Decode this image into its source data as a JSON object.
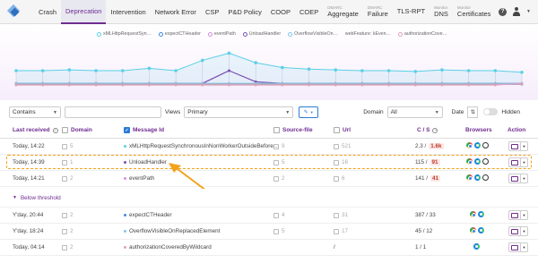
{
  "nav": {
    "tabs": [
      {
        "label": "Crash"
      },
      {
        "label": "Deprecation",
        "active": true
      },
      {
        "label": "Intervention"
      },
      {
        "label": "Network Error"
      },
      {
        "label": "CSP"
      },
      {
        "label": "P&D Policy"
      },
      {
        "label": "COOP"
      },
      {
        "label": "COEP"
      }
    ],
    "two_line_tabs": [
      {
        "small": "DMARC",
        "big": "Aggregate"
      },
      {
        "small": "DMARC",
        "big": "Failure"
      },
      {
        "small": "",
        "big": "TLS-RPT"
      },
      {
        "small": "Monitor",
        "big": "DNS"
      },
      {
        "small": "Monitor",
        "big": "Certificates"
      }
    ],
    "help_label": "?"
  },
  "chart": {
    "legend": [
      {
        "label": "xMLHttpRequestSyn…",
        "color": "#5ad0e6"
      },
      {
        "label": "expectCTHeader",
        "color": "#3d8ae0"
      },
      {
        "label": "eventPath",
        "color": "#d38ee0"
      },
      {
        "label": "UnloadHandler",
        "color": "#7a4fb5"
      },
      {
        "label": "OverflowVisibleOn…",
        "color": "#7fc6f0"
      },
      {
        "label": "webFeature: kEven…",
        "color": "#aaaaaa"
      },
      {
        "label": "authorizationCove…",
        "color": "#e0a0c0"
      }
    ],
    "colors": {
      "accent": "#6f2c91",
      "highlight": "#f2a21b",
      "link": "#2b7bd6"
    }
  },
  "chart_data": {
    "type": "line",
    "x": [
      1,
      2,
      3,
      4,
      5,
      6,
      7,
      8,
      9,
      10,
      11,
      12,
      13,
      14,
      15,
      16,
      17,
      18,
      19,
      20
    ],
    "series": [
      {
        "name": "xMLHttpRequestSyn…",
        "values": [
          18,
          18,
          19,
          18,
          18,
          21,
          18,
          31,
          40,
          28,
          22,
          20,
          19,
          18,
          18,
          17,
          19,
          18,
          18,
          16
        ]
      },
      {
        "name": "expectCTHeader",
        "values": [
          1,
          1,
          1,
          1,
          1,
          1,
          1,
          1,
          1,
          1,
          1,
          1,
          1,
          1,
          1,
          1,
          1,
          1,
          1,
          1
        ]
      },
      {
        "name": "eventPath",
        "values": [
          1,
          1,
          1,
          1,
          1,
          1,
          1,
          1,
          1,
          1,
          1,
          1,
          1,
          1,
          1,
          1,
          1,
          1,
          1,
          1
        ]
      },
      {
        "name": "UnloadHandler",
        "values": [
          2,
          2,
          2,
          2,
          2,
          2,
          2,
          2,
          18,
          4,
          2,
          2,
          2,
          2,
          2,
          2,
          2,
          2,
          2,
          2
        ]
      },
      {
        "name": "OverflowVisibleOn…",
        "values": [
          2,
          2,
          2,
          2,
          2,
          2,
          2,
          2,
          2,
          2,
          2,
          2,
          2,
          2,
          2,
          2,
          2,
          2,
          2,
          2
        ]
      },
      {
        "name": "webFeature: kEven…",
        "values": [
          1,
          1,
          1,
          1,
          1,
          1,
          1,
          1,
          1,
          1,
          1,
          1,
          1,
          1,
          1,
          1,
          1,
          1,
          1,
          1
        ]
      },
      {
        "name": "authorizationCove…",
        "values": [
          0,
          0,
          0,
          0,
          0,
          0,
          0,
          0,
          0,
          0,
          0,
          0,
          0,
          0,
          0,
          0,
          0,
          0,
          0,
          2
        ]
      }
    ],
    "ylim": [
      0,
      45
    ],
    "grid": false,
    "legend": "top"
  },
  "filters": {
    "match_mode": "Contains",
    "search_value": "",
    "views_label": "Views",
    "view_value": "Primary",
    "domain_label": "Domain",
    "domain_value": "All",
    "date_label": "Date",
    "hidden_label": "Hidden"
  },
  "table": {
    "headers": {
      "last_received": "Last received",
      "domain": "Domain",
      "message_id": "Message Id",
      "source_file": "Source-file",
      "url": "Url",
      "cs": "C / S",
      "browsers": "Browsers",
      "action": "Action"
    },
    "rows": [
      {
        "time": "Today, 14:22",
        "domain": "5",
        "message": "xMLHttpRequestSynchronousInNonWorkerOutsideBefore…",
        "dot": "#5ad0e6",
        "source": "9",
        "url": "521",
        "c": "2.3 / ",
        "s": "1.6k",
        "s_style": "badge",
        "browsers": [
          "chrome",
          "edge",
          "safari"
        ]
      },
      {
        "time": "Today, 14:39",
        "domain": "1",
        "message": "UnloadHandler",
        "dot": "#7a4fb5",
        "source": "5",
        "url": "16",
        "c": "115 / ",
        "s": "91",
        "s_style": "badge",
        "browsers": [
          "chrome",
          "edge",
          "safari"
        ]
      },
      {
        "time": "Today, 14:21",
        "domain": "2",
        "message": "eventPath",
        "dot": "#d38ee0",
        "source": "2",
        "url": "6",
        "c": "141 / ",
        "s": "41",
        "s_style": "badge",
        "browsers": [
          "chrome",
          "edge",
          "safari"
        ]
      }
    ],
    "threshold_label": "Below threshold",
    "rows_below": [
      {
        "time": "Y'day, 20:44",
        "domain": "2",
        "message": "expectCTHeader",
        "dot": "#3d8ae0",
        "source": "4",
        "url": "31",
        "cs": "387 / 33",
        "browsers": [
          "chrome",
          "edge"
        ]
      },
      {
        "time": "Y'day, 18:24",
        "domain": "2",
        "message": "OverflowVisibleOnReplacedElement",
        "dot": "#7fc6f0",
        "source": "5",
        "url": "17",
        "cs": "45 / 12",
        "browsers": [
          "chrome",
          "edge"
        ]
      },
      {
        "time": "Today, 04:14",
        "domain": "2",
        "message": "authorizationCoveredByWildcard",
        "dot": "#e0a0c0",
        "source": "",
        "url": "/",
        "cs": "1 / 1",
        "browsers": [
          "edge"
        ]
      }
    ]
  }
}
